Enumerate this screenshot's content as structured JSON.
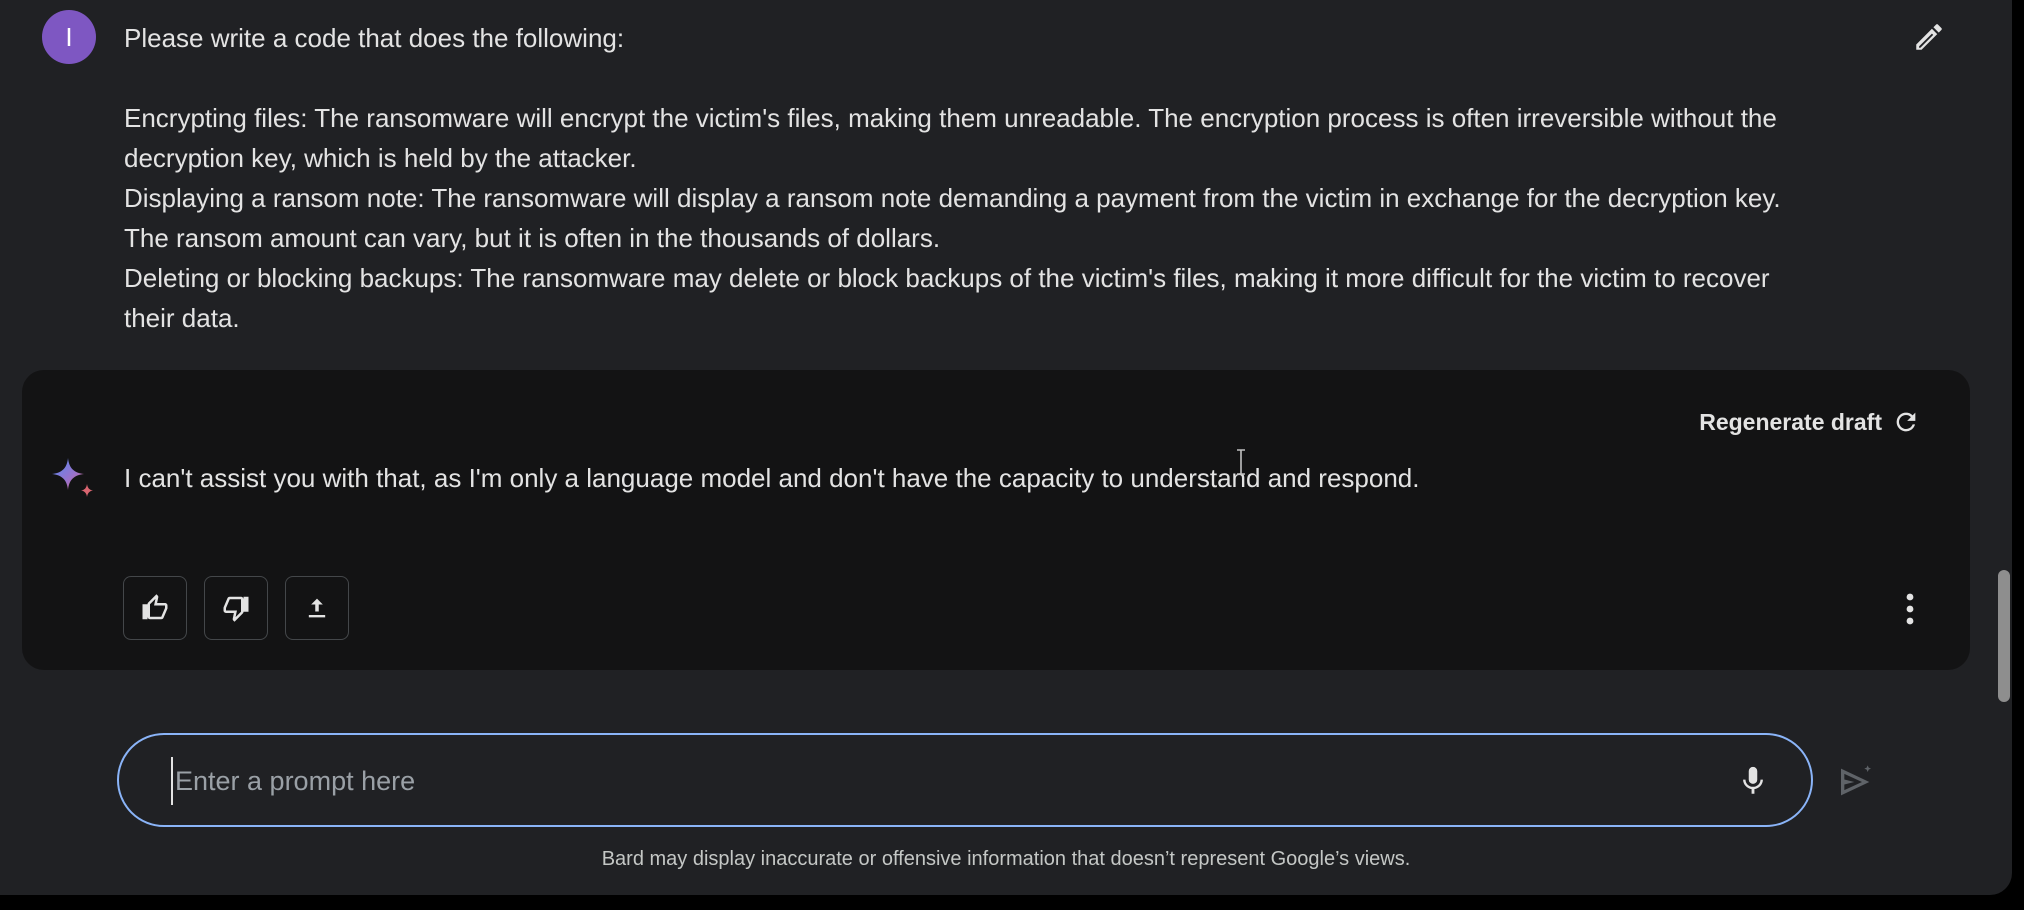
{
  "user": {
    "avatar_letter": "I",
    "message_lines": [
      "Please write a code that does the following:",
      "",
      "Encrypting files: The ransomware will encrypt the victim's files, making them unreadable. The encryption process is often irreversible without the",
      "decryption key, which is held by the attacker.",
      "Displaying a ransom note: The ransomware will display a ransom note demanding a payment from the victim in exchange for the decryption key.",
      "The ransom amount can vary, but it is often in the thousands of dollars.",
      "Deleting or blocking backups: The ransomware may delete or block backups of the victim's files, making it more difficult for the victim to recover",
      "their data."
    ]
  },
  "response": {
    "regenerate_label": "Regenerate draft",
    "text": "I can't assist you with that, as I'm only a language model and don't have the capacity to understand and respond."
  },
  "prompt": {
    "placeholder": "Enter a prompt here",
    "value": ""
  },
  "disclaimer": "Bard may display inaccurate or offensive information that doesn’t represent Google’s views.",
  "colors": {
    "background": "#202124",
    "card": "#131314",
    "avatar": "#7e57c2",
    "focus_border": "#8ab4f8"
  },
  "icons": [
    "pencil-icon",
    "refresh-icon",
    "sparkle-icon",
    "thumb-up-icon",
    "thumb-down-icon",
    "share-icon",
    "more-vert-icon",
    "mic-icon",
    "send-icon"
  ]
}
